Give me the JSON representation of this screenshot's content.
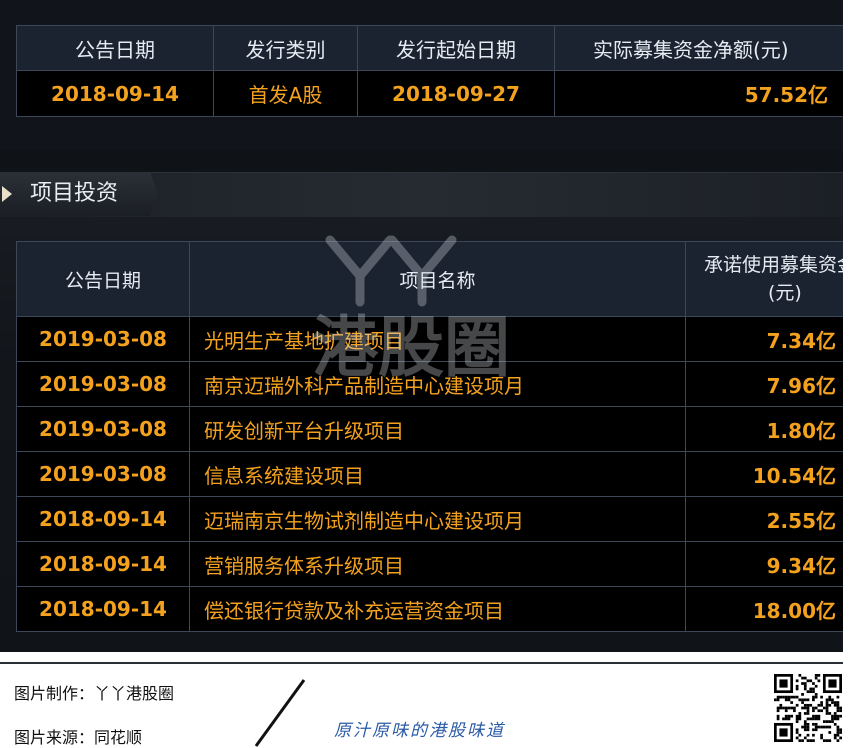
{
  "issue_table": {
    "headers": [
      "公告日期",
      "发行类别",
      "发行起始日期",
      "实际募集资金净额(元)"
    ],
    "row": [
      "2018-09-14",
      "首发A股",
      "2018-09-27",
      "57.52亿"
    ]
  },
  "section": {
    "title": "项目投资"
  },
  "project_table": {
    "headers": [
      "公告日期",
      "项目名称",
      "承诺使用募集资金",
      "(元)"
    ],
    "rows": [
      {
        "date": "2019-03-08",
        "name": "光明生产基地扩建项目",
        "amount": "7.34亿"
      },
      {
        "date": "2019-03-08",
        "name": "南京迈瑞外科产品制造中心建设项月",
        "amount": "7.96亿"
      },
      {
        "date": "2019-03-08",
        "name": "研发创新平台升级项目",
        "amount": "1.80亿"
      },
      {
        "date": "2019-03-08",
        "name": "信息系统建设项目",
        "amount": "10.54亿"
      },
      {
        "date": "2018-09-14",
        "name": "迈瑞南京生物试剂制造中心建设项月",
        "amount": "2.55亿"
      },
      {
        "date": "2018-09-14",
        "name": "营销服务体系升级项目",
        "amount": "9.34亿"
      },
      {
        "date": "2018-09-14",
        "name": "偿还银行贷款及补充运营资金项目",
        "amount": "18.00亿"
      }
    ]
  },
  "watermark": {
    "text": "港股圈"
  },
  "footer": {
    "maker": "图片制作：丫丫港股圈",
    "source": "图片来源：同花顺",
    "slogan": "原汁原味的港股味道"
  },
  "colors": {
    "accent": "#f4a21e",
    "background": "#0f1216",
    "border": "#3c4758",
    "header_bg": "#1b2330"
  }
}
